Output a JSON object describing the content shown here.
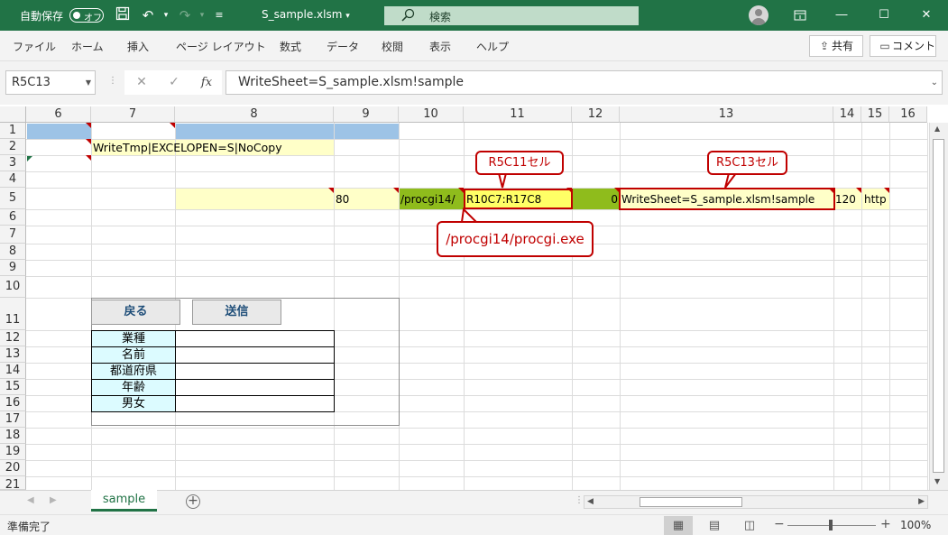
{
  "titlebar": {
    "autosave_label": "自動保存",
    "autosave_state": "オフ",
    "filename": "S_sample.xlsm",
    "filename_arrow": "▾",
    "search_placeholder": "検索"
  },
  "ribbon_tabs": [
    "ファイル",
    "ホーム",
    "挿入",
    "ページ レイアウト",
    "数式",
    "データ",
    "校閲",
    "表示",
    "ヘルプ"
  ],
  "ribbon_actions": {
    "share": "共有",
    "comment": "コメント"
  },
  "formula_bar": {
    "name_box": "R5C13",
    "formula": "WriteSheet=S_sample.xlsm!sample"
  },
  "column_headers": [
    "6",
    "7",
    "8",
    "9",
    "10",
    "11",
    "12",
    "13",
    "14",
    "15",
    "16"
  ],
  "row_headers": [
    "1",
    "2",
    "3",
    "4",
    "5",
    "6",
    "7",
    "8",
    "9",
    "10",
    "11",
    "12",
    "13",
    "14",
    "15",
    "16",
    "17",
    "18",
    "19",
    "20",
    "21"
  ],
  "cells": {
    "r2c7": "WriteTmp|EXCELOPEN=S|NoCopy",
    "r5c9": "80",
    "r5c10": "/procgi14/",
    "r5c11": "R10C7:R17C8",
    "r5c12": "0",
    "r5c13": "WriteSheet=S_sample.xlsm!sample",
    "r5c14": "120",
    "r5c15": "http"
  },
  "callouts": {
    "r5c11_label": "R5C11セル",
    "r5c13_label": "R5C13セル",
    "procgi_label": "/procgi14/procgi.exe"
  },
  "form": {
    "back_button": "戻る",
    "send_button": "送信",
    "labels": [
      "業種",
      "名前",
      "都道府県",
      "年齢",
      "男女"
    ]
  },
  "sheet_tabs": [
    "sample"
  ],
  "status": {
    "ready": "準備完了",
    "zoom": "100%"
  },
  "colors": {
    "title_green": "#217346",
    "blue_fill": "#9dc3e6",
    "light_yellow": "#ffffc8",
    "yellow": "#ffff66",
    "green_fill": "#8fbc1c",
    "callout_red": "#c00000",
    "form_label_fill": "#dcfbff"
  },
  "icons": [
    "save-icon",
    "undo-icon",
    "redo-icon",
    "customize-icon",
    "search-icon",
    "account-icon",
    "ribbon-display-icon",
    "minimize-icon",
    "maximize-icon",
    "close-icon",
    "share-icon",
    "comment-icon",
    "cancel-icon",
    "enter-icon",
    "function-icon",
    "add-sheet-icon",
    "normal-view-icon",
    "page-layout-icon",
    "page-break-icon"
  ]
}
